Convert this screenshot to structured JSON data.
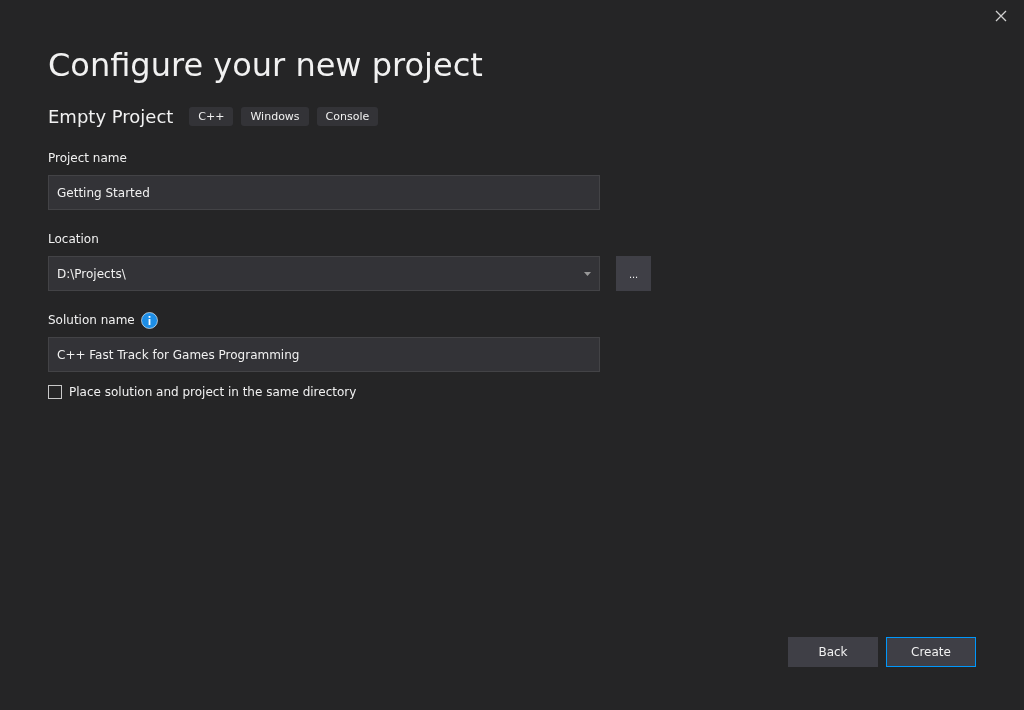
{
  "window": {
    "title": "Configure your new project"
  },
  "template": {
    "name": "Empty Project",
    "tags": [
      "C++",
      "Windows",
      "Console"
    ]
  },
  "fields": [
    {
      "kind": "text",
      "label": "Project name",
      "value": "Getting Started"
    },
    {
      "kind": "dropdown",
      "label": "Location",
      "value": "D:\\Projects\\",
      "browse": "..."
    },
    {
      "kind": "text",
      "label": "Solution name",
      "info": true,
      "value": "C++ Fast Track for Games Programming"
    }
  ],
  "options": [
    {
      "label": "Place solution and project in the same directory",
      "checked": false
    }
  ],
  "buttons": [
    {
      "label": "Back",
      "primary": false
    },
    {
      "label": "Create",
      "primary": true
    }
  ]
}
